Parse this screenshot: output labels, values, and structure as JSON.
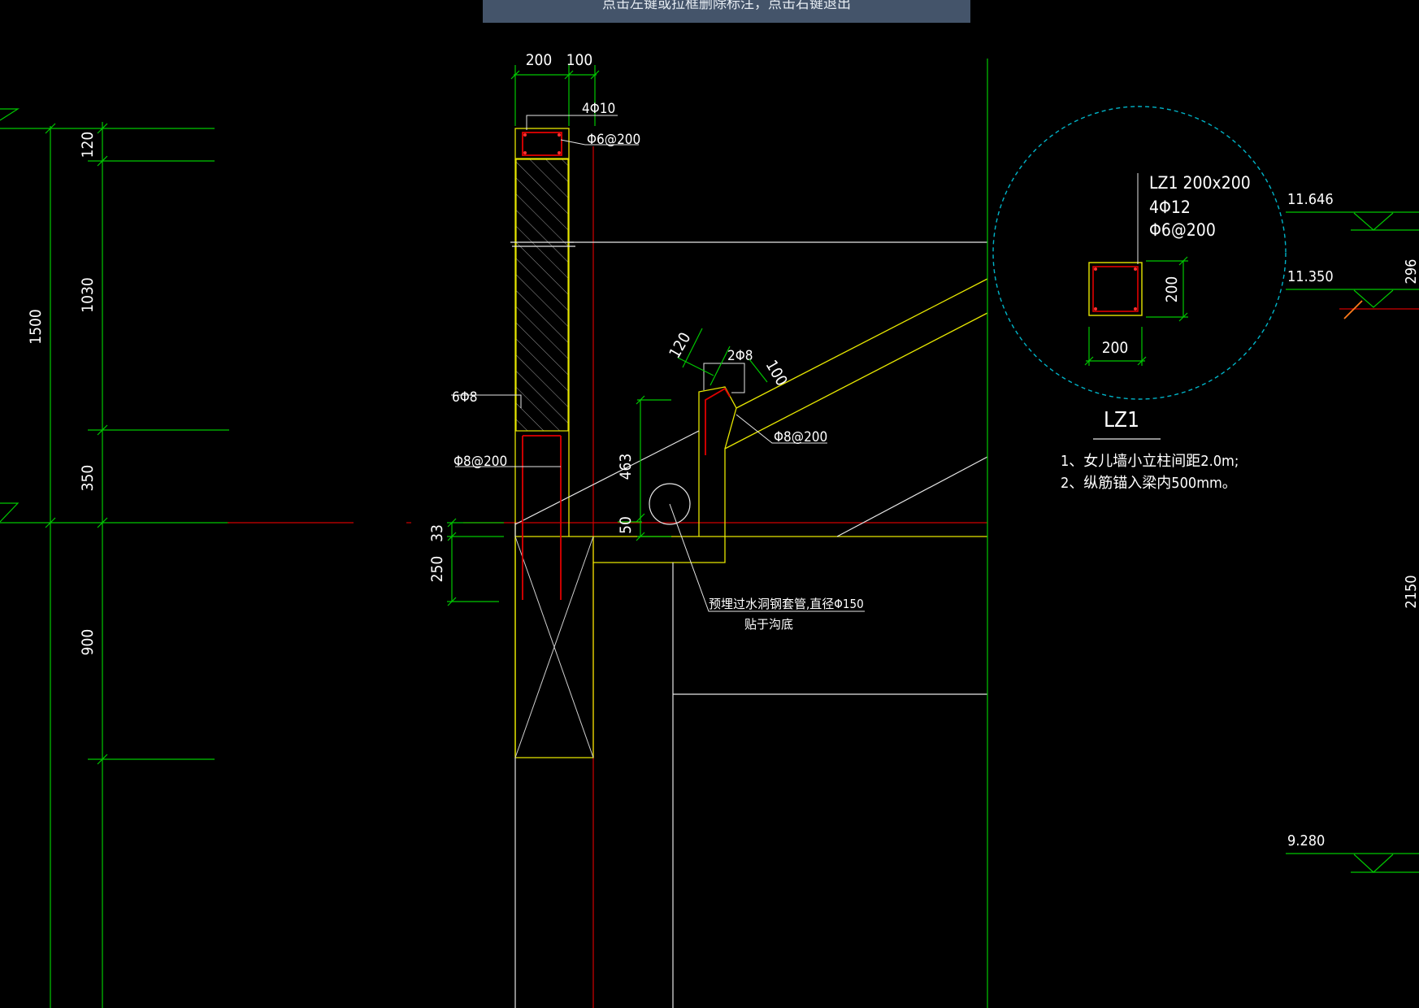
{
  "status_prompt": "点击左键或拉框删除标注，点击右键退出",
  "colors": {
    "background": "#000000",
    "dimension": "#00c800",
    "outline": "#e6e600",
    "rebar": "#e00000",
    "axis": "#d00000",
    "text": "#ffffff",
    "detail_circle": "#00b4c8",
    "banner": "#44546a"
  },
  "left_dims": {
    "total": "1500",
    "d120": "120",
    "d1030": "1030",
    "d350": "350",
    "d900": "900"
  },
  "top_dims": {
    "w200": "200",
    "w100": "100"
  },
  "rebar_labels": {
    "top_main": "4Φ10",
    "top_stirrup": "Φ6@200",
    "side_main": "6Φ8",
    "side_stirrup": "Φ8@200",
    "gutter_main": "2Φ8",
    "gutter_stirrup": "Φ8@200"
  },
  "gutter_dims": {
    "d120": "120",
    "d100": "100",
    "d463": "463",
    "d50": "50"
  },
  "beam_dims": {
    "d33": "33",
    "d250": "250"
  },
  "pipe_note": {
    "line1": "预埋过水洞钢套管,直径Φ150",
    "line2": "贴于沟底"
  },
  "detail": {
    "header": "LZ1 200x200",
    "main_bars": "4Φ12",
    "stirrups": "Φ6@200",
    "dim_h": "200",
    "dim_w": "200",
    "title": "LZ1",
    "note1": "1、女儿墙小立柱间距2.0m;",
    "note2": "2、纵筋锚入梁内500mm。"
  },
  "elevations": {
    "e1": "11.646",
    "e2": "11.350",
    "e3": "9.280"
  },
  "right_dims": {
    "d296": "296",
    "d2150": "2150"
  }
}
